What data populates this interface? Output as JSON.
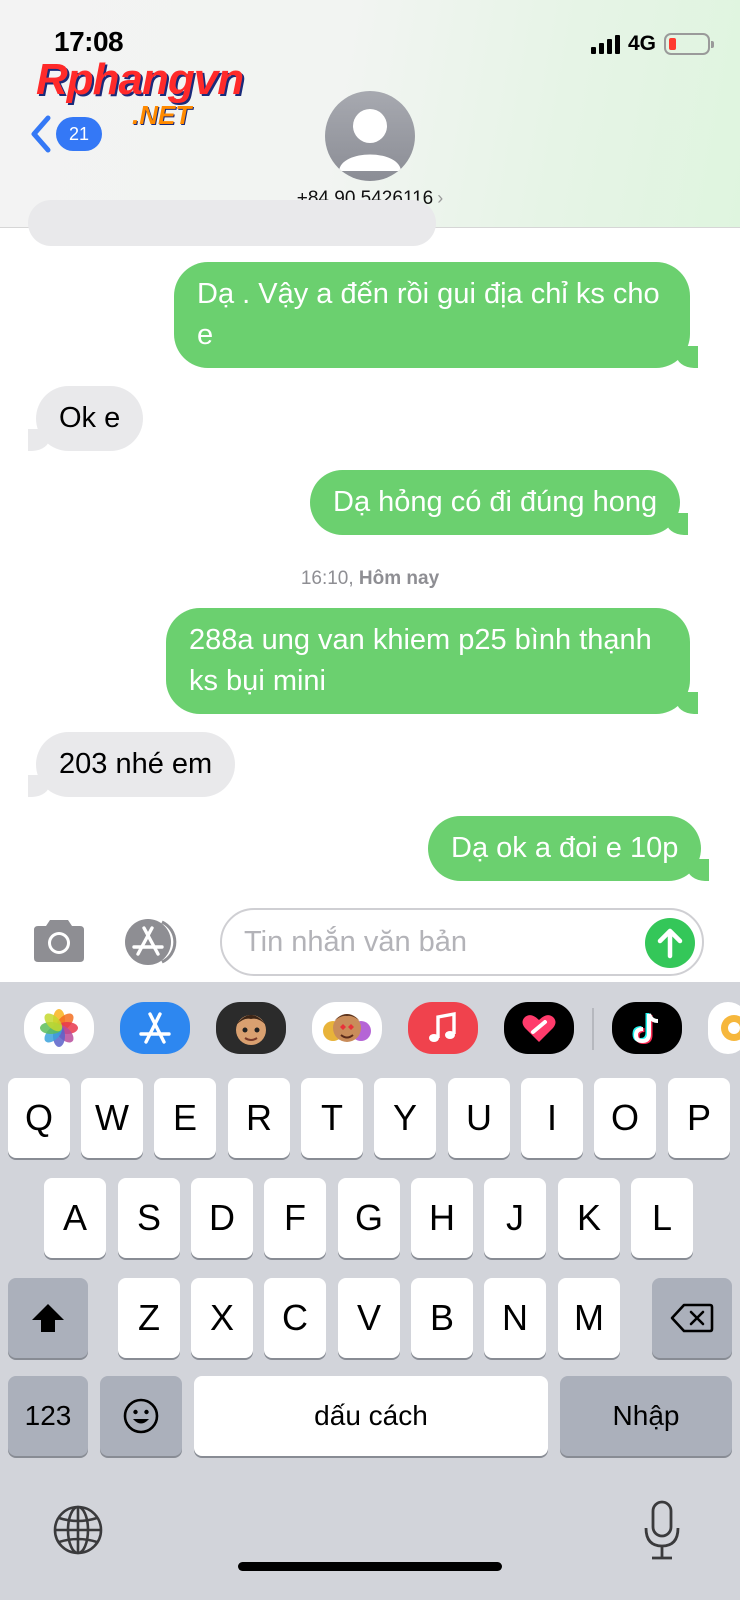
{
  "status_bar": {
    "time": "17:08",
    "network": "4G"
  },
  "watermark": {
    "line1": "Rphangvn",
    "line2": ".NET"
  },
  "nav": {
    "back_count": "21",
    "contact": "+84 90 5426116",
    "chevron": "›"
  },
  "messages": [
    {
      "side": "out",
      "text": "Dạ . Vậy a đến rồi gui địa chỉ ks cho e"
    },
    {
      "side": "in",
      "text": "Ok e"
    },
    {
      "side": "out",
      "text": "Dạ hỏng có đi đúng hong"
    },
    {
      "side": "out",
      "text": "288a ung van khiem p25 bình thạnh ks bụi mini"
    },
    {
      "side": "in",
      "text": "203 nhé em"
    },
    {
      "side": "out",
      "text": "Dạ ok a đoi e 10p"
    }
  ],
  "timestamp": {
    "time": "16:10,",
    "day": "Hôm nay"
  },
  "composer": {
    "placeholder": "Tin nhắn văn bản"
  },
  "app_strip": [
    "photos-icon",
    "app-store-icon",
    "memoji-icon",
    "animoji-icon",
    "music-icon",
    "digital-touch-icon",
    "tiktok-icon",
    "more-apps-icon"
  ],
  "keyboard": {
    "row1": [
      "Q",
      "W",
      "E",
      "R",
      "T",
      "Y",
      "U",
      "I",
      "O",
      "P"
    ],
    "row2": [
      "A",
      "S",
      "D",
      "F",
      "G",
      "H",
      "J",
      "K",
      "L"
    ],
    "row3": [
      "Z",
      "X",
      "C",
      "V",
      "B",
      "N",
      "M"
    ],
    "numbers": "123",
    "space": "dấu cách",
    "return": "Nhập"
  },
  "colors": {
    "outgoing": "#6bd06f",
    "incoming": "#e9e9eb",
    "accent": "#3478f6",
    "send": "#34c759"
  }
}
